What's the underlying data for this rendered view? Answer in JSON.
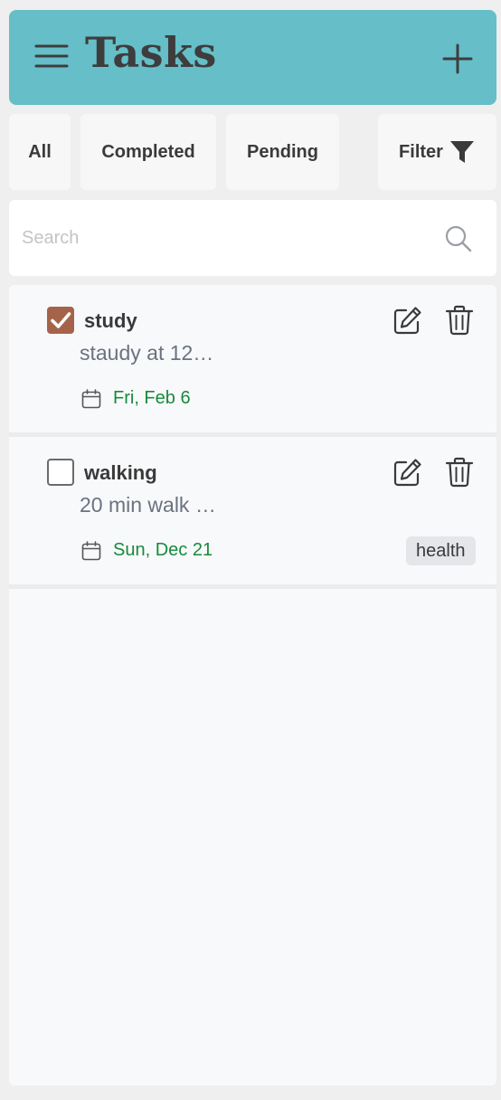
{
  "header": {
    "title": "Tasks",
    "menu_icon": "hamburger-menu-icon",
    "add_icon": "plus-icon",
    "background_color": "#66bec8"
  },
  "tabs": {
    "all": "All",
    "completed": "Completed",
    "pending": "Pending",
    "filter": "Filter",
    "filter_icon": "funnel-icon"
  },
  "search": {
    "placeholder": "Search",
    "value": "",
    "icon": "search-icon"
  },
  "tasks": [
    {
      "title": "study",
      "description": "staudy at 12…",
      "date": "Fri, Feb 6",
      "completed": true,
      "tag": ""
    },
    {
      "title": "walking",
      "description": "20 min walk …",
      "date": "Sun, Dec 21",
      "completed": false,
      "tag": "health"
    }
  ],
  "colors": {
    "checked_accent": "#a5644a",
    "date_text": "#178a3c",
    "tag_background": "#e4e6ea"
  }
}
